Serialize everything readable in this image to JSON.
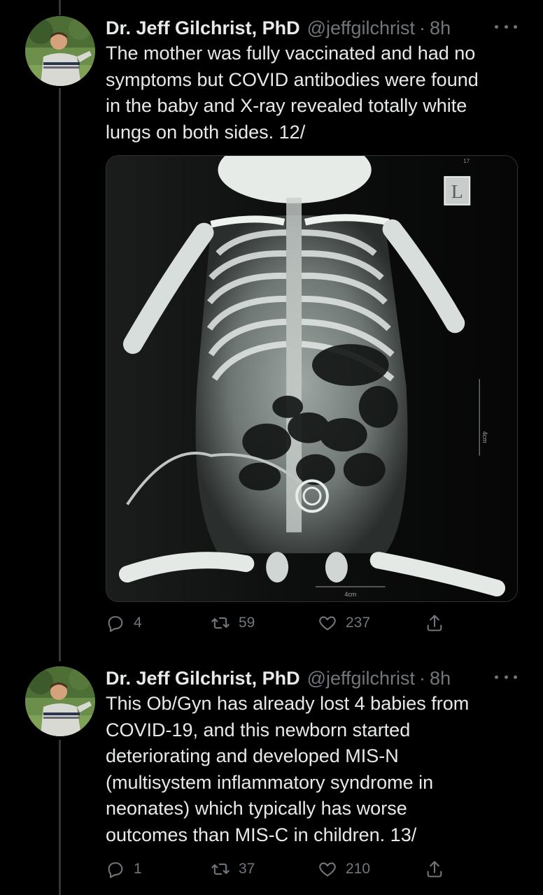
{
  "tweets": [
    {
      "name": "Dr. Jeff Gilchrist, PhD",
      "handle": "@jeffgilchrist",
      "separator": "·",
      "time": "8h",
      "text_lines": [
        "The mother was fully vaccinated and had no",
        "symptoms but COVID antibodies were found",
        "in the baby and X-ray revealed totally white",
        "lungs on both sides. 12/"
      ],
      "media": {
        "marker_letter": "L",
        "scale_label_right": "4cm",
        "scale_label_bottom": "4cm",
        "top_label": "17"
      },
      "replies": "4",
      "retweets": "59",
      "likes": "237"
    },
    {
      "name": "Dr. Jeff Gilchrist, PhD",
      "handle": "@jeffgilchrist",
      "separator": "·",
      "time": "8h",
      "text_lines": [
        "This Ob/Gyn has already lost 4 babies from",
        "COVID-19, and this newborn started",
        "deteriorating and developed MIS-N",
        "(multisystem inflammatory syndrome in",
        "neonates) which typically has worse",
        "outcomes than MIS-C in children. 13/"
      ],
      "replies": "1",
      "retweets": "37",
      "likes": "210"
    }
  ],
  "icons": {
    "reply": "reply-icon",
    "retweet": "retweet-icon",
    "like": "heart-icon",
    "share": "share-icon",
    "more": "more-icon"
  },
  "colors": {
    "background": "#000000",
    "text": "#e7e9ea",
    "muted": "#71767b",
    "divider": "#333639"
  }
}
